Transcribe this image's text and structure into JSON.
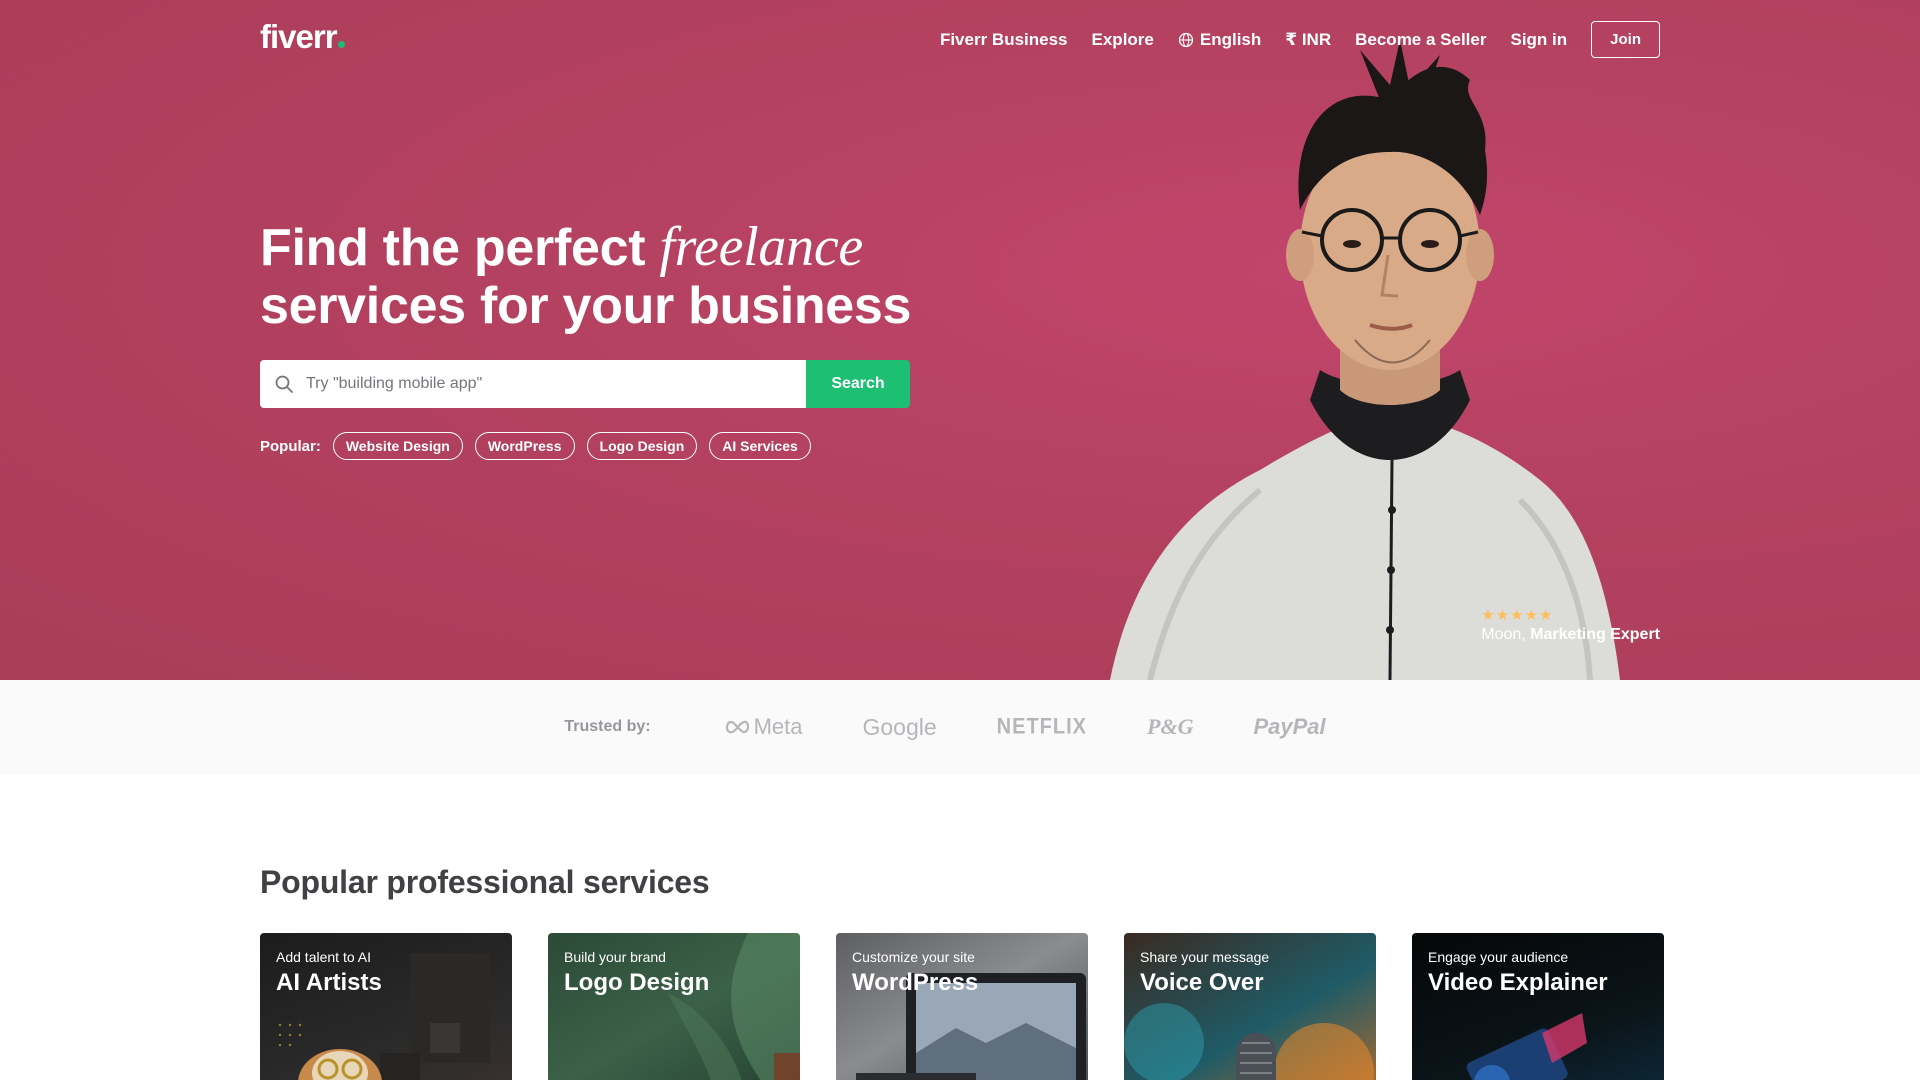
{
  "nav": {
    "logo": "fiverr",
    "links": {
      "business": "Fiverr Business",
      "explore": "Explore",
      "language": "English",
      "currency": "₹ INR",
      "become_seller": "Become a Seller",
      "sign_in": "Sign in"
    },
    "join": "Join"
  },
  "hero": {
    "title_line1_a": "Find the perfect ",
    "title_line1_b": "freelance",
    "title_line2": "services for your business",
    "search": {
      "placeholder": "Try \"building mobile app\"",
      "button": "Search"
    },
    "popular_label": "Popular:",
    "popular_chips": [
      "Website Design",
      "WordPress",
      "Logo Design",
      "AI Services"
    ],
    "seller": {
      "stars": "★★★★★",
      "name": "Moon,",
      "role": "Marketing Expert"
    }
  },
  "trusted": {
    "label": "Trusted by:",
    "brands": [
      "Meta",
      "Google",
      "NETFLIX",
      "P&G",
      "PayPal"
    ]
  },
  "services": {
    "title": "Popular professional services",
    "cards": [
      {
        "subtitle": "Add talent to AI",
        "title": "AI Artists"
      },
      {
        "subtitle": "Build your brand",
        "title": "Logo Design"
      },
      {
        "subtitle": "Customize your site",
        "title": "WordPress"
      },
      {
        "subtitle": "Share your message",
        "title": "Voice Over"
      },
      {
        "subtitle": "Engage your audience",
        "title": "Video Explainer"
      }
    ]
  },
  "colors": {
    "hero_bg": "#b3415f",
    "accent_green": "#1dbf73",
    "star_color": "#ffbe5b"
  }
}
